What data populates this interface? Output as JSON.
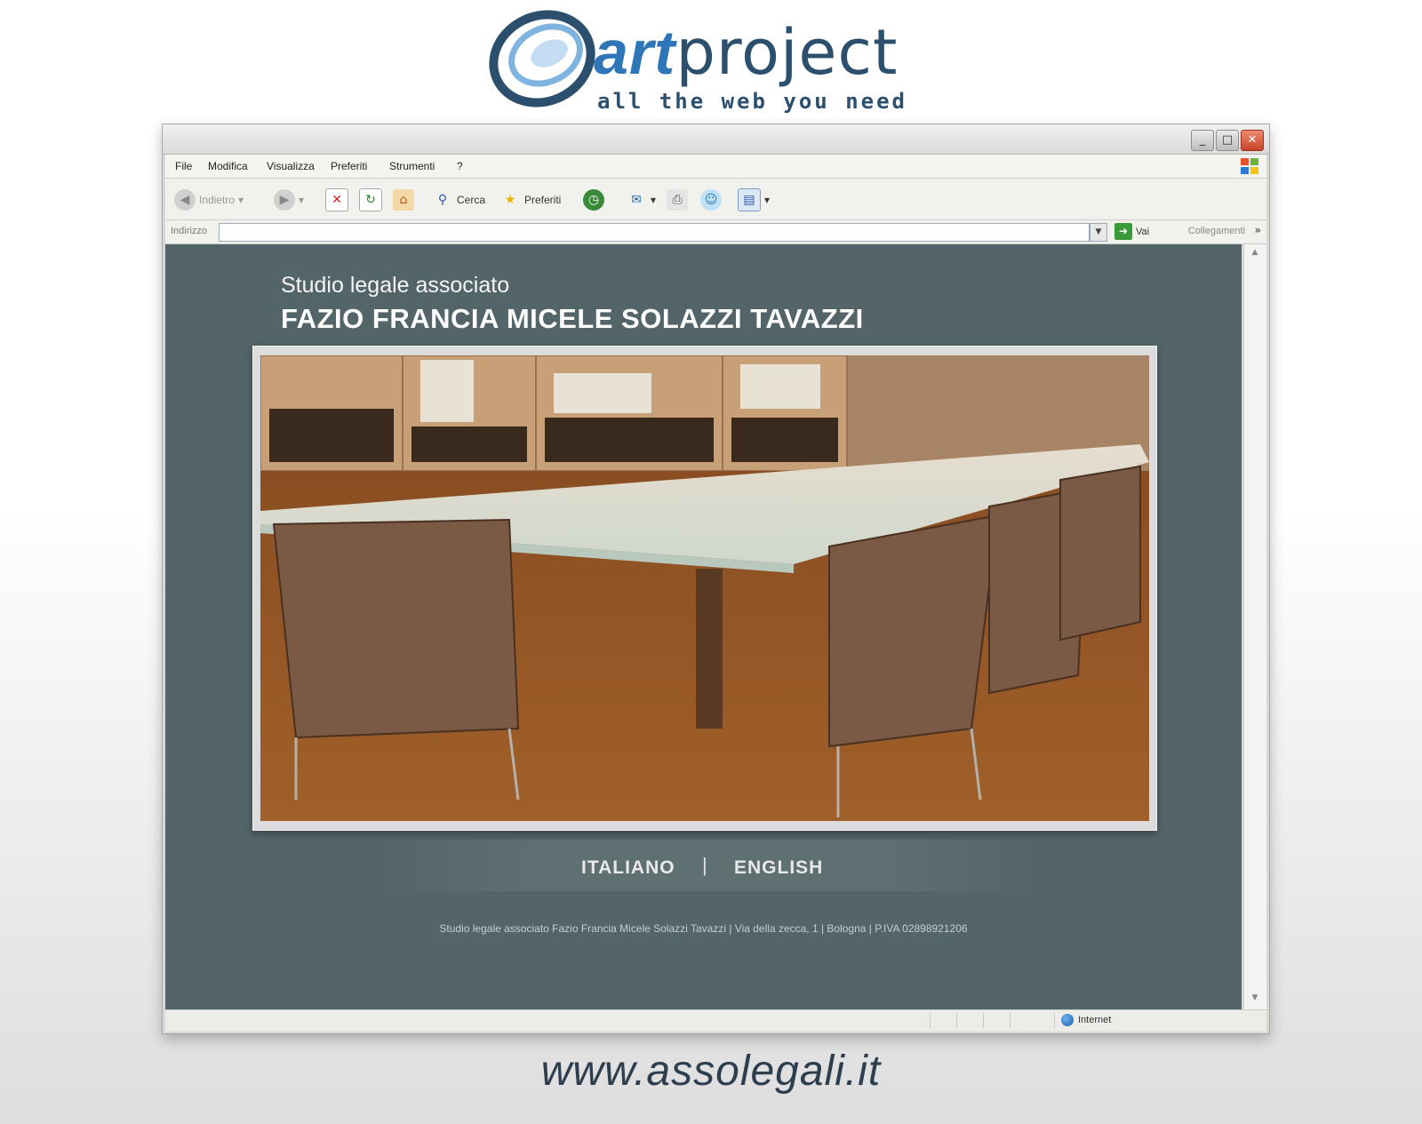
{
  "brand": {
    "logo_text_bold": "art",
    "logo_text_regular": "project",
    "tagline": "all the web you need",
    "colors": {
      "blue": "#2f76b8",
      "navy": "#2c4f6e"
    }
  },
  "browser": {
    "menu": [
      "File",
      "Modifica",
      "Visualizza",
      "Preferiti",
      "Strumenti",
      "?"
    ],
    "toolbar": {
      "back_label": "Indietro",
      "search_label": "Cerca",
      "favorites_label": "Preferiti"
    },
    "address": {
      "label": "Indirizzo",
      "value": "",
      "go_label": "Vai",
      "links_label": "Collegamenti"
    },
    "status": {
      "zone_label": "Internet"
    },
    "window_buttons": {
      "minimize": "_",
      "maximize": "□",
      "close": "✕"
    }
  },
  "site": {
    "subtitle": "Studio legale associato",
    "title": "FAZIO FRANCIA MICELE SOLAZZI TAVAZZI",
    "lang_it": "ITALIANO",
    "lang_separator": "|",
    "lang_en": "ENGLISH",
    "footer": "Studio legale associato Fazio Francia Micele Solazzi Tavazzi  |  Via della zecca, 1  |  Bologna  |  P.IVA 02898921206",
    "background_color": "#536568"
  },
  "caption": {
    "url": "www.assolegali.it"
  }
}
